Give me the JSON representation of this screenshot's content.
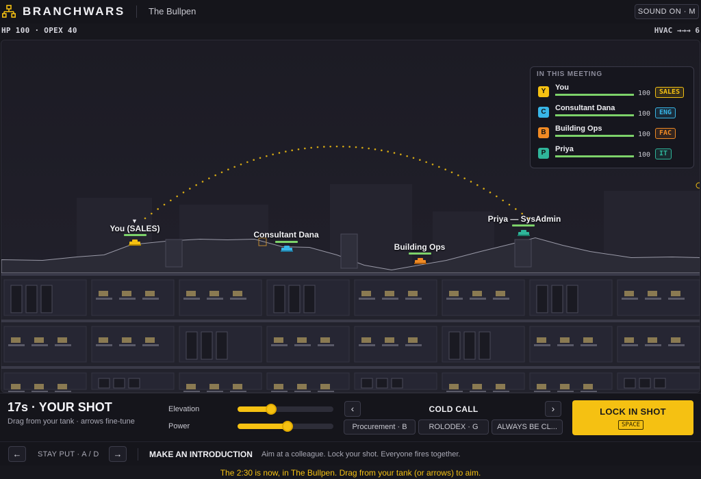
{
  "app": {
    "title": "BRANCHWARS",
    "level": "The Bullpen",
    "sound": "SOUND ON · M"
  },
  "stats": {
    "left": "HP 100 · OPEX 40",
    "wind": "HVAC →→→ 6"
  },
  "players": [
    {
      "label": "You (SALES)",
      "color": "#f5c112",
      "hp": 100
    },
    {
      "label": "Consultant Dana",
      "color": "#38b6e8",
      "hp": 100
    },
    {
      "label": "Building Ops",
      "color": "#f08a24",
      "hp": 100
    },
    {
      "label": "Priya — SysAdmin",
      "color": "#2fb59a",
      "hp": 100
    }
  ],
  "meeting": {
    "title": "IN THIS MEETING",
    "rows": [
      {
        "initial": "Y",
        "name": "You",
        "hp": "100",
        "tag": "SALES",
        "color": "#f5c112"
      },
      {
        "initial": "C",
        "name": "Consultant Dana",
        "hp": "100",
        "tag": "ENG",
        "color": "#38b6e8"
      },
      {
        "initial": "B",
        "name": "Building Ops",
        "hp": "100",
        "tag": "FAC",
        "color": "#f08a24"
      },
      {
        "initial": "P",
        "name": "Priya",
        "hp": "100",
        "tag": "IT",
        "color": "#2fb59a"
      }
    ]
  },
  "turn": {
    "title": "17s · YOUR SHOT",
    "hint": "Drag from your tank · arrows fine-tune"
  },
  "aim": {
    "elevation_label": "Elevation",
    "elevation": 0.35,
    "power_label": "Power",
    "power": 0.52
  },
  "weapon": {
    "name": "COLD CALL",
    "prev_icon": "chevron-left-icon",
    "next_icon": "chevron-right-icon",
    "options": [
      "Procurement · B",
      "ROLODEX · G",
      "ALWAYS BE CL..."
    ]
  },
  "fire": {
    "label": "LOCK IN SHOT",
    "key": "SPACE"
  },
  "move": {
    "label": "STAY PUT · A / D",
    "left_icon": "arrow-left-icon",
    "right_icon": "arrow-right-icon"
  },
  "objective": {
    "title": "MAKE AN INTRODUCTION",
    "text": "Aim at a colleague. Lock your shot. Everyone fires together."
  },
  "status": "The 2:30 is now, in The Bullpen. Drag from your tank (or arrows) to aim."
}
